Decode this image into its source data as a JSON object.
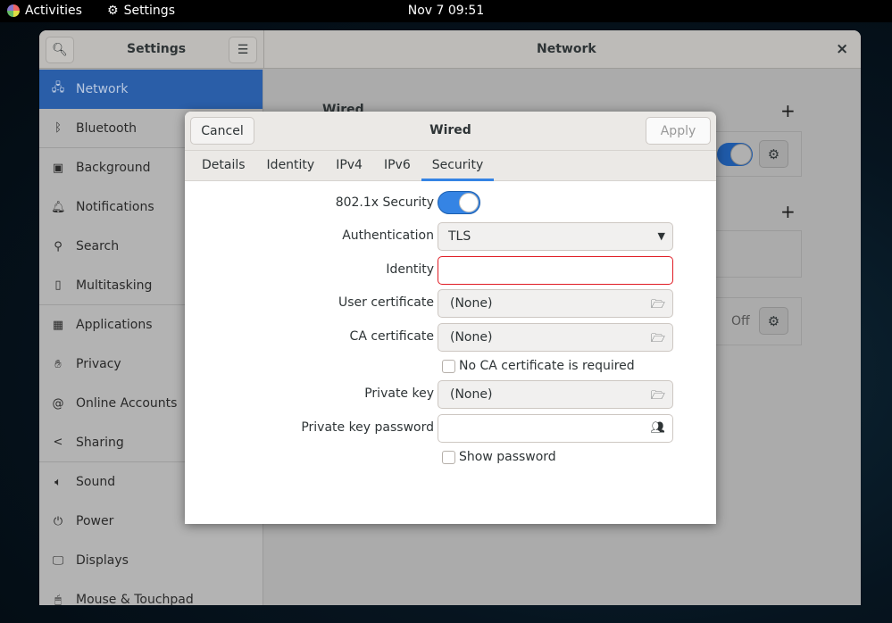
{
  "topbar": {
    "activities": "Activities",
    "app": "Settings",
    "clock": "Nov 7  09:51"
  },
  "window": {
    "sidebar_title": "Settings",
    "content_title": "Network",
    "close": "×"
  },
  "sidebar": {
    "items": [
      {
        "label": "Network",
        "icon": "network-icon"
      },
      {
        "label": "Bluetooth",
        "icon": "bluetooth-icon"
      },
      {
        "label": "Background",
        "icon": "background-icon"
      },
      {
        "label": "Notifications",
        "icon": "bell-icon"
      },
      {
        "label": "Search",
        "icon": "search-icon"
      },
      {
        "label": "Multitasking",
        "icon": "multitasking-icon"
      },
      {
        "label": "Applications",
        "icon": "applications-icon"
      },
      {
        "label": "Privacy",
        "icon": "hand-icon"
      },
      {
        "label": "Online Accounts",
        "icon": "at-icon"
      },
      {
        "label": "Sharing",
        "icon": "share-icon"
      },
      {
        "label": "Sound",
        "icon": "speaker-icon"
      },
      {
        "label": "Power",
        "icon": "power-icon"
      },
      {
        "label": "Displays",
        "icon": "display-icon"
      },
      {
        "label": "Mouse & Touchpad",
        "icon": "mouse-icon"
      }
    ]
  },
  "network": {
    "wired_heading": "Wired",
    "plus": "+",
    "off_label": "Off"
  },
  "dialog": {
    "cancel": "Cancel",
    "title": "Wired",
    "apply": "Apply",
    "tabs": [
      "Details",
      "Identity",
      "IPv4",
      "IPv6",
      "Security"
    ],
    "active_tab": "Security",
    "security_label": "802.1x Security",
    "security_enabled": true,
    "auth_label": "Authentication",
    "auth_value": "TLS",
    "identity_label": "Identity",
    "identity_value": "",
    "user_cert_label": "User certificate",
    "user_cert_value": "(None)",
    "ca_cert_label": "CA certificate",
    "ca_cert_value": "(None)",
    "no_ca_label": "No CA certificate is required",
    "no_ca_checked": false,
    "private_key_label": "Private key",
    "private_key_value": "(None)",
    "pk_password_label": "Private key password",
    "pk_password_value": "",
    "show_password_label": "Show password",
    "show_password_checked": false
  },
  "colors": {
    "accent": "#3584e4",
    "error": "#e01b24",
    "selected_sidebar": "#2a5ea8"
  }
}
